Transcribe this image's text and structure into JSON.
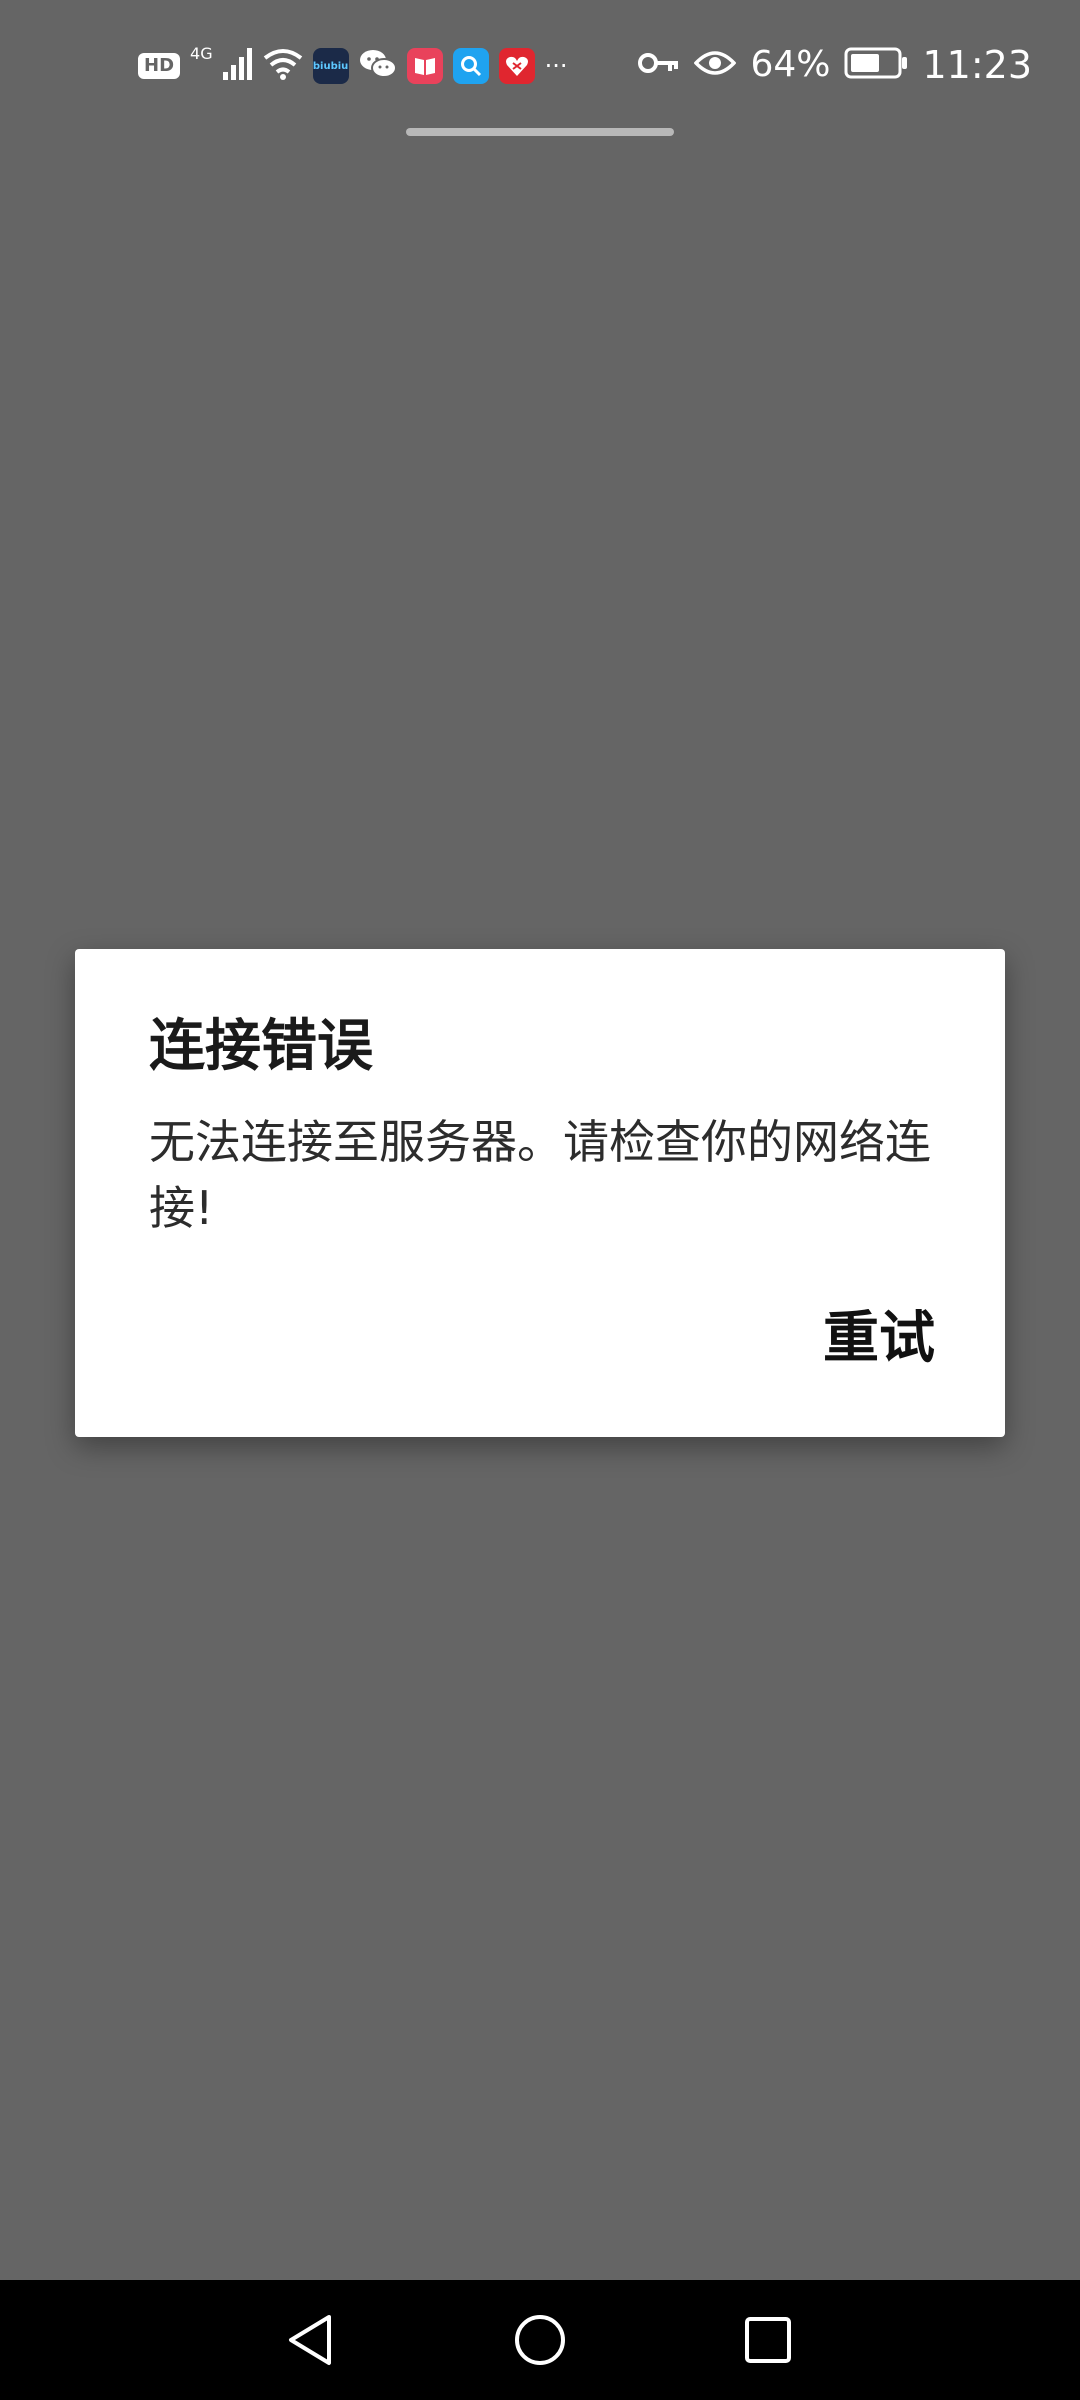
{
  "status_bar": {
    "hd_label": "HD",
    "network_label": "4G",
    "app_badge_text": "biubiu",
    "more_label": "···",
    "battery_percent": "64%",
    "time": "11:23",
    "battery_level": 0.64
  },
  "dialog": {
    "title": "连接错误",
    "message": "无法连接至服务器。请检查你的网络连接!",
    "retry_label": "重试"
  },
  "nav_bar": {
    "icons": [
      "back-icon",
      "home-icon",
      "recents-icon"
    ]
  },
  "colors": {
    "background": "#656565",
    "dialog_bg": "#ffffff",
    "nav_bg": "#000000"
  }
}
